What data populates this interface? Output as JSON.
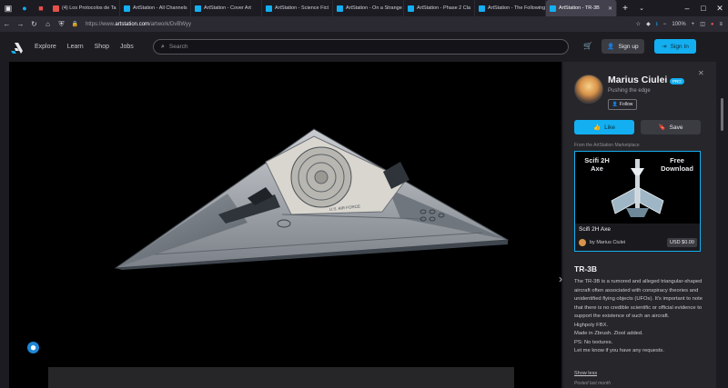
{
  "browser": {
    "tabs": [
      {
        "label": "(4) Los Protocolos de Ta",
        "favicon_color": "#e6514a"
      },
      {
        "label": "ArtStation - All Channels",
        "favicon_color": "#13aff0"
      },
      {
        "label": "ArtStation - Cover Art",
        "favicon_color": "#13aff0"
      },
      {
        "label": "ArtStation - Science Fict",
        "favicon_color": "#13aff0"
      },
      {
        "label": "ArtStation - On a Strange",
        "favicon_color": "#13aff0"
      },
      {
        "label": "ArtStation - Phase 2 Cla",
        "favicon_color": "#13aff0"
      },
      {
        "label": "ArtStation - The Following",
        "favicon_color": "#13aff0"
      },
      {
        "label": "ArtStation - TR-3B",
        "favicon_color": "#13aff0",
        "active": true
      }
    ],
    "url_prefix": "https://www.",
    "url_domain": "artstation.com",
    "url_path": "/artwork/DvBWyy",
    "zoom": "100%"
  },
  "site": {
    "nav": [
      "Explore",
      "Learn",
      "Shop",
      "Jobs"
    ],
    "search_placeholder": "Search",
    "signup_label": "Sign up",
    "signin_label": "Sign In",
    "accent": "#13aff0"
  },
  "artist": {
    "name": "Marius Ciulei",
    "badge": "PRO",
    "tagline": "Pushing the edge",
    "follow_label": "Follow"
  },
  "actions": {
    "like_label": "Like",
    "save_label": "Save"
  },
  "marketplace": {
    "heading": "From the ArtStation Marketplace",
    "image_text_left": "Scifi 2H Axe",
    "image_text_right": "Free Download",
    "product_title": "Scifi 2H Axe",
    "by_label": "by Marius Ciulei",
    "price": "USD $0.00"
  },
  "artwork": {
    "title": "TR-3B",
    "description": [
      "The TR-3B is a rumored and alleged triangular-shaped aircraft often associated with conspiracy theories and unidentified flying objects (UFOs). It's important to note that there is no credible scientific or official evidence to support the existence of such an aircraft.",
      "Highpoly FBX.",
      "Made in Zbrush. Ztool added.",
      "PS: No textures.",
      "Let me know if you have any requests."
    ],
    "show_less": "Show less",
    "posted": "Posted last month",
    "hull_label": "U.S. AIR FORCE"
  }
}
